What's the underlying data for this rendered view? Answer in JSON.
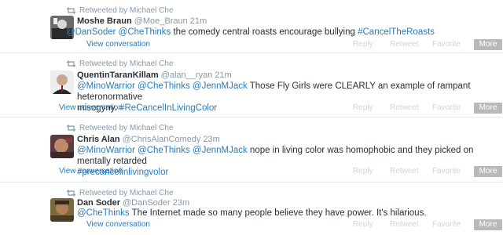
{
  "tweets": [
    {
      "retweeted_by": "Retweeted by Michael Che",
      "name": "Moshe Braun",
      "handle": "@Moe_Braun",
      "time": "21m",
      "mentions": "@DanSoder @CheThinks",
      "text_a": " the comedy central roasts encourage bullying ",
      "hashtag": "#CancelTheRoasts",
      "view_conversation": "View conversation",
      "reply": "Reply",
      "retweet": "Retweet",
      "favorite": "Favorite",
      "more": "More"
    },
    {
      "retweeted_by": "Retweeted by Michael Che",
      "name": "QuentinTaranKillam",
      "handle": "@alan__ryan",
      "time": "21m",
      "mentions": "@MinoWarrior @CheThinks @JennMJack",
      "text_a": " Those Fly Girls were CLEARLY an example of rampant heteronormative",
      "text_b": "misogyny. ",
      "hashtag": "#ReCancelInLivingColor",
      "view_conversation": "View conversation",
      "reply": "Reply",
      "retweet": "Retweet",
      "favorite": "Favorite",
      "more": "More"
    },
    {
      "retweeted_by": "Retweeted by Michael Che",
      "name": "Chris Alan",
      "handle": "@ChrisAlanComedy",
      "time": "23m",
      "mentions": "@MinoWarrior @CheThinks @JennMJack",
      "text_a": " nope in living color was homophobic and they picked on mentally retarded",
      "hashtag": "#precancelinlivingvolor",
      "view_conversation": "View conversation",
      "reply": "Reply",
      "retweet": "Retweet",
      "favorite": "Favorite",
      "more": "More"
    },
    {
      "retweeted_by": "Retweeted by Michael Che",
      "name": "Dan Soder",
      "handle": "@DanSoder",
      "time": "23m",
      "mentions": "@CheThinks",
      "text_a": " The Internet made so many people believe they have power. It's hilarious.",
      "view_conversation": "View conversation",
      "reply": "Reply",
      "retweet": "Retweet",
      "favorite": "Favorite",
      "more": "More"
    }
  ],
  "colors": {
    "link": "#2b7bb9",
    "muted": "#8899a6",
    "action": "#ccd6dd",
    "more_button": "#b9b9b9",
    "divider": "#e1e8ed"
  },
  "icons": {
    "retweet": "retweet-icon"
  }
}
